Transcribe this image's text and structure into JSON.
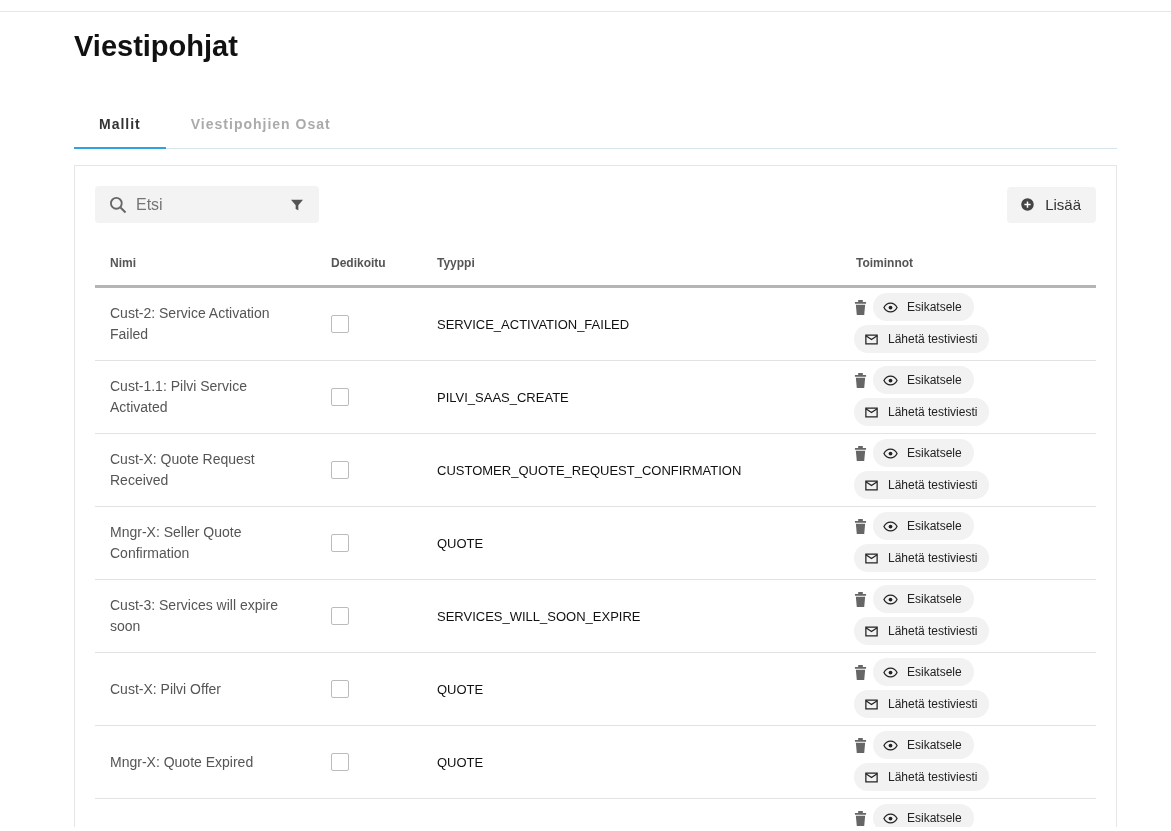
{
  "page_title": "Viestipohjat",
  "tabs": [
    {
      "label": "Mallit",
      "selected": true
    },
    {
      "label": "Viestipohjien Osat",
      "selected": false
    }
  ],
  "search": {
    "placeholder": "Etsi"
  },
  "add_button": {
    "label": "Lisää"
  },
  "table": {
    "columns": [
      "Nimi",
      "Dedikoitu",
      "Tyyppi",
      "Toiminnot"
    ],
    "rows": [
      {
        "name": "Cust-2: Service Activation Failed",
        "dedicated": false,
        "type": "SERVICE_ACTIVATION_FAILED",
        "actions": [
          {
            "kind": "delete"
          },
          {
            "kind": "preview",
            "label": "Esikatsele"
          },
          {
            "kind": "send",
            "label": "Lähetä testiviesti"
          }
        ]
      },
      {
        "name": "Cust-1.1: Pilvi Service Activated",
        "dedicated": false,
        "type": "PILVI_SAAS_CREATE",
        "actions": [
          {
            "kind": "delete"
          },
          {
            "kind": "preview",
            "label": "Esikatsele"
          },
          {
            "kind": "send",
            "label": "Lähetä testiviesti"
          }
        ]
      },
      {
        "name": "Cust-X: Quote Request Received",
        "dedicated": false,
        "type": "CUSTOMER_QUOTE_REQUEST_CONFIRMATION",
        "actions": [
          {
            "kind": "delete"
          },
          {
            "kind": "preview",
            "label": "Esikatsele"
          },
          {
            "kind": "send",
            "label": "Lähetä testiviesti"
          }
        ]
      },
      {
        "name": "Mngr-X: Seller Quote Confirmation",
        "dedicated": false,
        "type": "QUOTE",
        "actions": [
          {
            "kind": "delete"
          },
          {
            "kind": "preview",
            "label": "Esikatsele"
          },
          {
            "kind": "send",
            "label": "Lähetä testiviesti"
          }
        ]
      },
      {
        "name": "Cust-3: Services will expire soon",
        "dedicated": false,
        "type": "SERVICES_WILL_SOON_EXPIRE",
        "actions": [
          {
            "kind": "delete"
          },
          {
            "kind": "preview",
            "label": "Esikatsele"
          },
          {
            "kind": "send",
            "label": "Lähetä testiviesti"
          }
        ]
      },
      {
        "name": "Cust-X: Pilvi Offer",
        "dedicated": false,
        "type": "QUOTE",
        "actions": [
          {
            "kind": "delete"
          },
          {
            "kind": "preview",
            "label": "Esikatsele"
          },
          {
            "kind": "send",
            "label": "Lähetä testiviesti"
          }
        ]
      },
      {
        "name": "Mngr-X: Quote Expired",
        "dedicated": false,
        "type": "QUOTE",
        "actions": [
          {
            "kind": "delete"
          },
          {
            "kind": "preview",
            "label": "Esikatsele"
          },
          {
            "kind": "send",
            "label": "Lähetä testiviesti"
          }
        ]
      },
      {
        "actions": [
          {
            "kind": "delete"
          },
          {
            "kind": "preview",
            "label": "Esikatsele"
          }
        ]
      }
    ]
  }
}
